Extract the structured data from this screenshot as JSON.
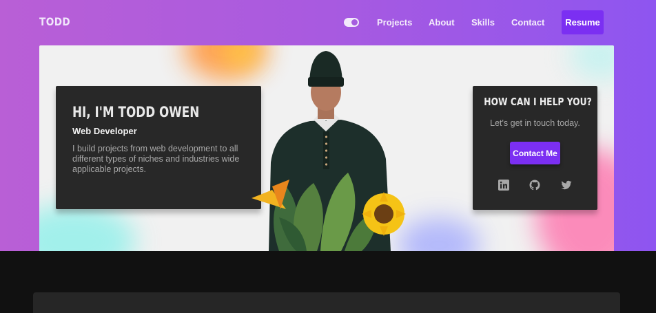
{
  "nav": {
    "logo": "TODD",
    "links": [
      "Projects",
      "About",
      "Skills",
      "Contact"
    ],
    "resume_label": "Resume",
    "theme_toggle": "toggle-icon"
  },
  "hero": {
    "title": "HI, I'M TODD OWEN",
    "subtitle": "Web Developer",
    "description": "I build projects from web development to all different types of niches and industries wide applicable projects."
  },
  "help_card": {
    "title": "HOW CAN I HELP YOU?",
    "subtitle": "Let's get in touch today.",
    "button_label": "Contact Me",
    "social_icons": [
      "linkedin-icon",
      "github-icon",
      "twitter-icon"
    ]
  },
  "colors": {
    "accent": "#7b2ff2",
    "header_gradient_start": "#b95fd6",
    "header_gradient_end": "#8e55f0",
    "card_bg": "#282828",
    "page_bg": "#111111"
  }
}
